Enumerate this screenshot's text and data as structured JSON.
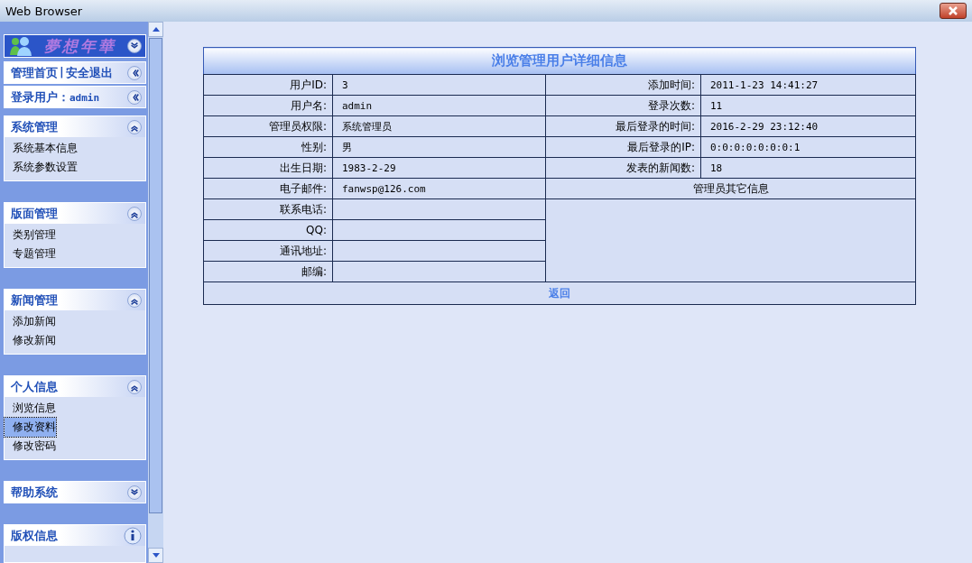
{
  "window": {
    "title": "Web Browser"
  },
  "sidebar": {
    "logo": "夢想年華",
    "logo_expanded": false,
    "links": [
      {
        "label": "管理首页"
      },
      {
        "label": "安全退出"
      }
    ],
    "separator": "|",
    "user": {
      "label": "登录用户：",
      "value": "admin"
    },
    "sections": [
      {
        "title": "系统管理",
        "expanded": true,
        "items": [
          {
            "label": "系统基本信息",
            "selected": false
          },
          {
            "label": "系统参数设置",
            "selected": false
          }
        ]
      },
      {
        "title": "版面管理",
        "expanded": true,
        "items": [
          {
            "label": "类别管理",
            "selected": false
          },
          {
            "label": "专题管理",
            "selected": false
          }
        ]
      },
      {
        "title": "新闻管理",
        "expanded": true,
        "items": [
          {
            "label": "添加新闻",
            "selected": false
          },
          {
            "label": "修改新闻",
            "selected": false
          }
        ]
      },
      {
        "title": "个人信息",
        "expanded": true,
        "items": [
          {
            "label": "浏览信息",
            "selected": false
          },
          {
            "label": "修改资料",
            "selected": true
          },
          {
            "label": "修改密码",
            "selected": false
          }
        ]
      },
      {
        "title": "帮助系统",
        "expanded": false
      }
    ],
    "copyright": {
      "title": "版权信息"
    }
  },
  "table": {
    "title": "浏览管理用户详细信息",
    "left": [
      {
        "label": "用户ID:",
        "value": "3"
      },
      {
        "label": "用户名:",
        "value": "admin"
      },
      {
        "label": "管理员权限:",
        "value": "系统管理员"
      },
      {
        "label": "性别:",
        "value": "男"
      },
      {
        "label": "出生日期:",
        "value": "1983-2-29"
      },
      {
        "label": "电子邮件:",
        "value": "fanwsp@126.com"
      },
      {
        "label": "联系电话:"
      },
      {
        "label": "QQ:"
      },
      {
        "label": "通讯地址:"
      },
      {
        "label": "邮编:"
      }
    ],
    "right": [
      {
        "label": "添加时间:",
        "value": "2011-1-23 14:41:27"
      },
      {
        "label": "登录次数:",
        "value": "11"
      },
      {
        "label": "最后登录的时间:",
        "value": "2016-2-29 23:12:40"
      },
      {
        "label": "最后登录的IP:",
        "value": "0:0:0:0:0:0:0:1"
      },
      {
        "label": "发表的新闻数:",
        "value": "18"
      }
    ],
    "other_title": "管理员其它信息",
    "back_link": "返回"
  }
}
